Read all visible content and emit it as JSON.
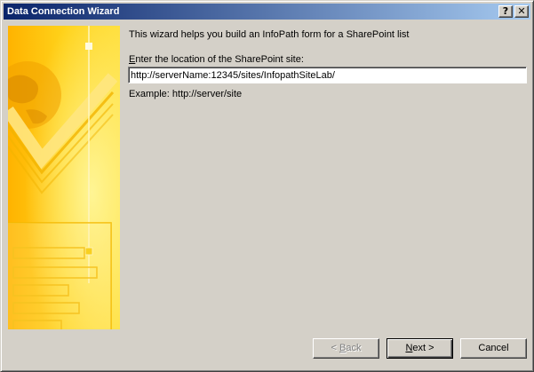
{
  "window": {
    "title": "Data Connection Wizard",
    "help_label": "?",
    "close_label": "✕"
  },
  "main": {
    "intro_text": "This wizard helps you build an InfoPath form for a SharePoint list",
    "location_label_accel": "E",
    "location_label_rest": "nter the location of the SharePoint site:",
    "location_value": "http://serverName:12345/sites/InfopathSiteLab/",
    "example_text": "Example: http://server/site"
  },
  "buttons": {
    "back_prefix": "< ",
    "back_accel": "B",
    "back_rest": "ack",
    "next_accel": "N",
    "next_rest": "ext >",
    "cancel_label": "Cancel"
  },
  "colors": {
    "titlebar_start": "#0a246a",
    "titlebar_end": "#a6caf0",
    "dialog_face": "#d4d0c8",
    "banner": "#ffc800"
  },
  "icons": {
    "banner": "globe-checkmark-form-illustration"
  }
}
